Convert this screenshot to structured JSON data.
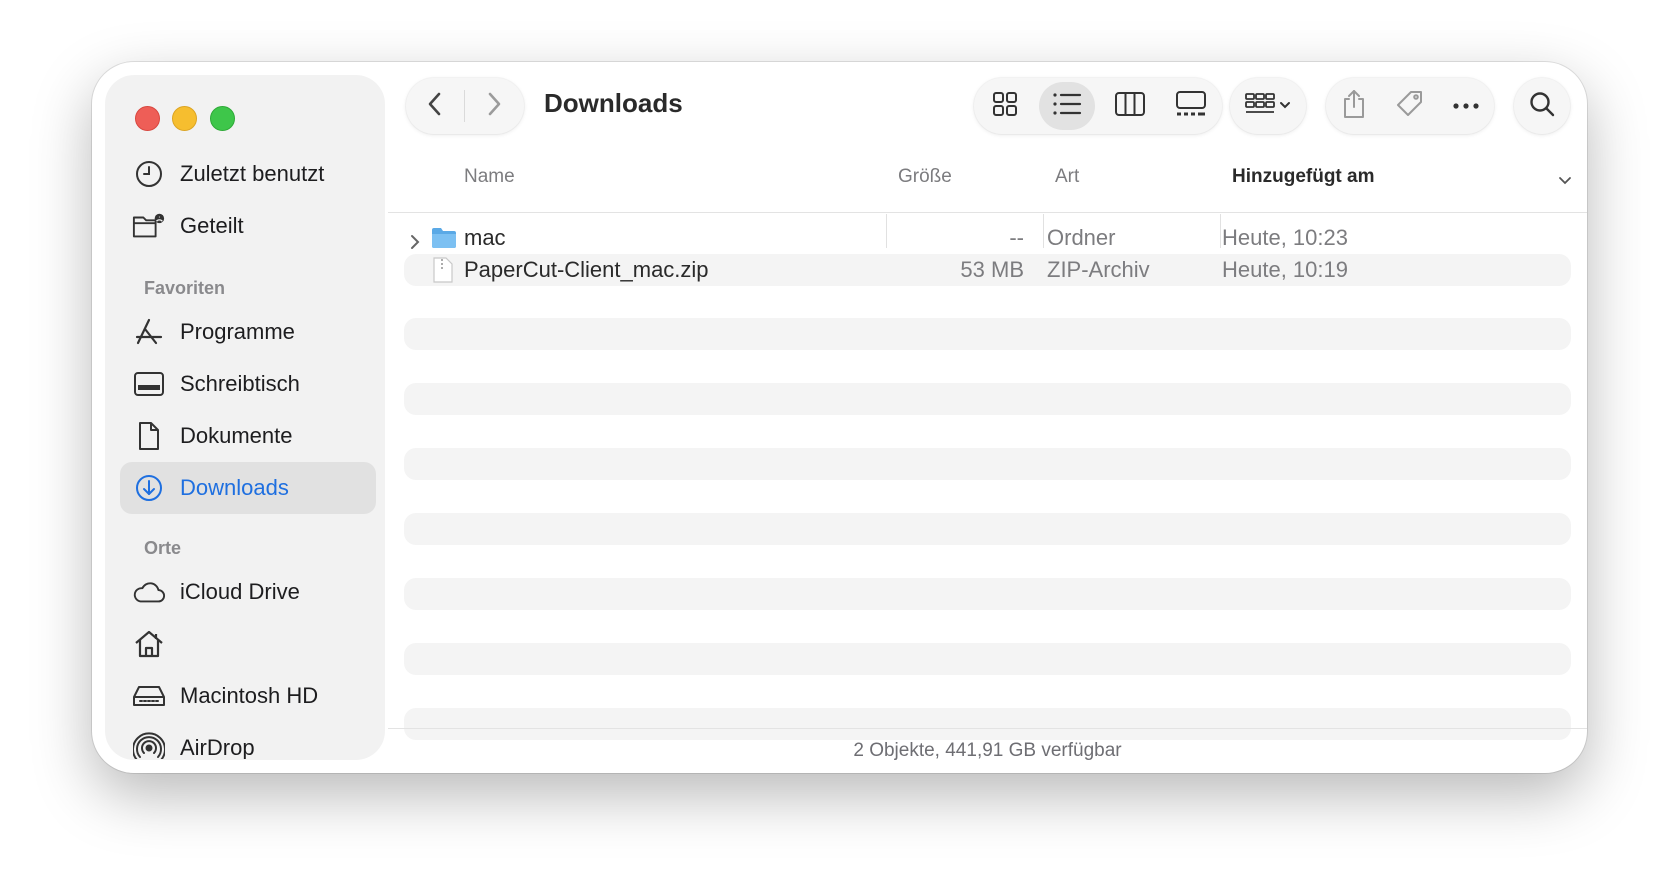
{
  "window": {
    "title": "Downloads"
  },
  "sidebar": {
    "top_items": [
      {
        "label": "Zuletzt benutzt",
        "icon": "clock-icon"
      },
      {
        "label": "Geteilt",
        "icon": "shared-folder-icon"
      }
    ],
    "favorites_header": "Favoriten",
    "favorites": [
      {
        "label": "Programme",
        "icon": "applications-icon"
      },
      {
        "label": "Schreibtisch",
        "icon": "desktop-icon"
      },
      {
        "label": "Dokumente",
        "icon": "document-icon"
      },
      {
        "label": "Downloads",
        "icon": "download-icon",
        "active": true
      }
    ],
    "places_header": "Orte",
    "places": [
      {
        "label": "iCloud Drive",
        "icon": "cloud-icon"
      },
      {
        "label": "",
        "icon": "home-icon"
      },
      {
        "label": "Macintosh HD",
        "icon": "hard-drive-icon"
      },
      {
        "label": "AirDrop",
        "icon": "airdrop-icon"
      }
    ]
  },
  "toolbar": {
    "view_modes": [
      "icon-view",
      "list-view",
      "column-view",
      "gallery-view"
    ],
    "selected_view": "list-view"
  },
  "columns": {
    "name": "Name",
    "size": "Größe",
    "kind": "Art",
    "date_added": "Hinzugefügt am"
  },
  "files": [
    {
      "name": "mac",
      "size": "--",
      "kind": "Ordner",
      "date_added": "Heute, 10:23",
      "icon": "folder-icon"
    },
    {
      "name": "PaperCut-Client_mac.zip",
      "size": "53 MB",
      "kind": "ZIP-Archiv",
      "date_added": "Heute, 10:19",
      "icon": "zip-file-icon"
    }
  ],
  "status": {
    "text": "2 Objekte, 441,91 GB verfügbar"
  },
  "colors": {
    "accent": "#1e6fe0",
    "close": "#ee5e57",
    "minimize": "#f6be2f",
    "zoom": "#3ec64a"
  }
}
